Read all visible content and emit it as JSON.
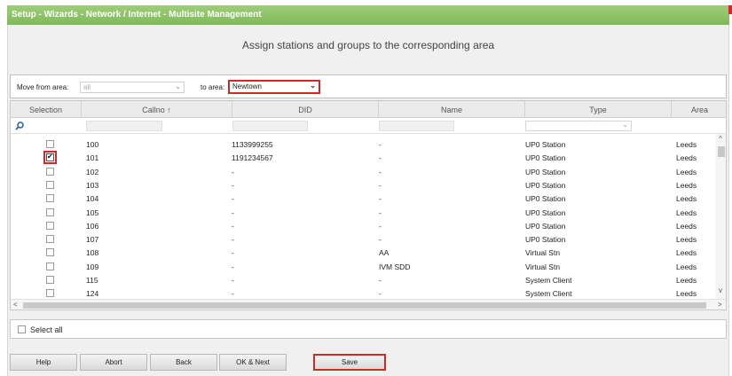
{
  "title": "Setup - Wizards - Network / Internet - Multisite Management",
  "heading": "Assign stations and groups to the corresponding area",
  "move": {
    "from_label": "Move from area:",
    "from_value": "all",
    "to_label": "to area:",
    "to_value": "Newtown"
  },
  "columns": [
    "Selection",
    "Callno ↑",
    "DID",
    "Name",
    "Type",
    "Area"
  ],
  "rows": [
    {
      "checked": false,
      "callno": "100",
      "did": "1133999255",
      "name": "-",
      "type": "UP0 Station",
      "area": "Leeds"
    },
    {
      "checked": true,
      "callno": "101",
      "did": "1191234567",
      "name": "-",
      "type": "UP0 Station",
      "area": "Leeds"
    },
    {
      "checked": false,
      "callno": "102",
      "did": "-",
      "name": "-",
      "type": "UP0 Station",
      "area": "Leeds"
    },
    {
      "checked": false,
      "callno": "103",
      "did": "-",
      "name": "-",
      "type": "UP0 Station",
      "area": "Leeds"
    },
    {
      "checked": false,
      "callno": "104",
      "did": "-",
      "name": "-",
      "type": "UP0 Station",
      "area": "Leeds"
    },
    {
      "checked": false,
      "callno": "105",
      "did": "-",
      "name": "-",
      "type": "UP0 Station",
      "area": "Leeds"
    },
    {
      "checked": false,
      "callno": "106",
      "did": "-",
      "name": "-",
      "type": "UP0 Station",
      "area": "Leeds"
    },
    {
      "checked": false,
      "callno": "107",
      "did": "-",
      "name": "-",
      "type": "UP0 Station",
      "area": "Leeds"
    },
    {
      "checked": false,
      "callno": "108",
      "did": "-",
      "name": "AA",
      "type": "Virtual Stn",
      "area": "Leeds"
    },
    {
      "checked": false,
      "callno": "109",
      "did": "-",
      "name": "IVM SDD",
      "type": "Virtual Stn",
      "area": "Leeds"
    },
    {
      "checked": false,
      "callno": "115",
      "did": "-",
      "name": "-",
      "type": "System Client",
      "area": "Leeds"
    },
    {
      "checked": false,
      "callno": "124",
      "did": "-",
      "name": "-",
      "type": "System Client",
      "area": "Leeds"
    }
  ],
  "select_all": "Select all",
  "buttons": {
    "help": "Help",
    "abort": "Abort",
    "back": "Back",
    "ok_next": "OK & Next",
    "save": "Save"
  },
  "colors": {
    "titlebar": "#8cc366",
    "highlight": "#d02828"
  }
}
